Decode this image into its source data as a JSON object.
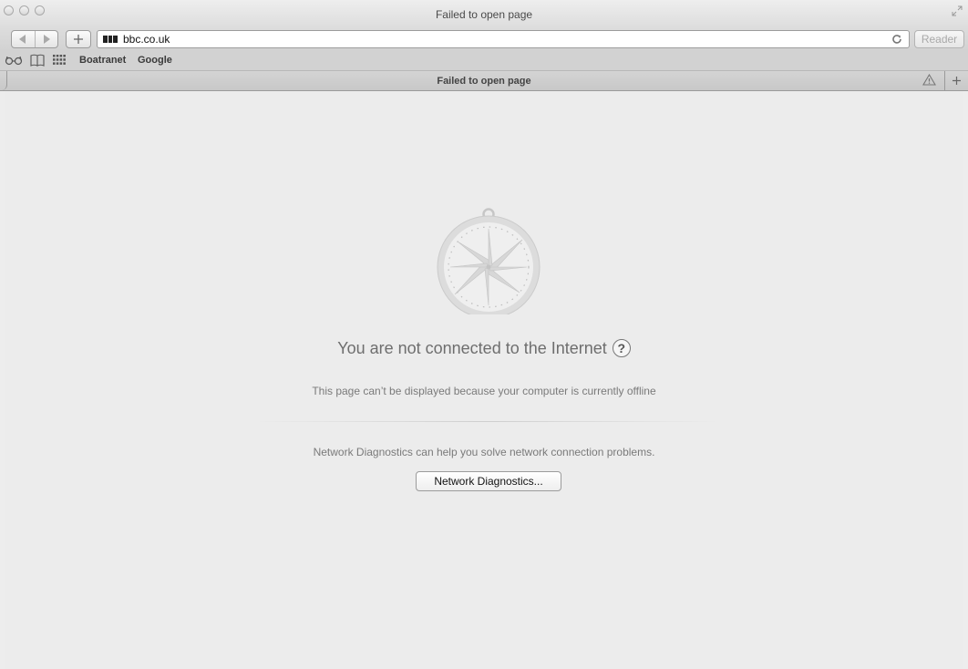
{
  "window": {
    "title": "Failed to open page"
  },
  "toolbar": {
    "url": "bbc.co.uk",
    "reader_label": "Reader"
  },
  "bookmarks": {
    "items": [
      "Boatranet",
      "Google"
    ]
  },
  "tab": {
    "title": "Failed to open page"
  },
  "error_page": {
    "headline": "You are not connected to the Internet",
    "help_symbol": "?",
    "subtitle": "This page can’t be displayed because your computer is currently offline",
    "diagnostics_text": "Network Diagnostics can help you solve network connection problems.",
    "diagnostics_button": "Network Diagnostics..."
  },
  "icons": {
    "traffic": [
      "close-icon",
      "minimize-icon",
      "zoom-icon"
    ],
    "nav": [
      "back-icon",
      "forward-icon"
    ],
    "bookmark_bar": [
      "reading-list-icon",
      "bookmarks-icon",
      "top-sites-icon"
    ],
    "page": "compass-icon"
  },
  "colors": {
    "background": "#ececec",
    "headline": "#6e6e6e",
    "body_text": "#7a7a7a"
  }
}
